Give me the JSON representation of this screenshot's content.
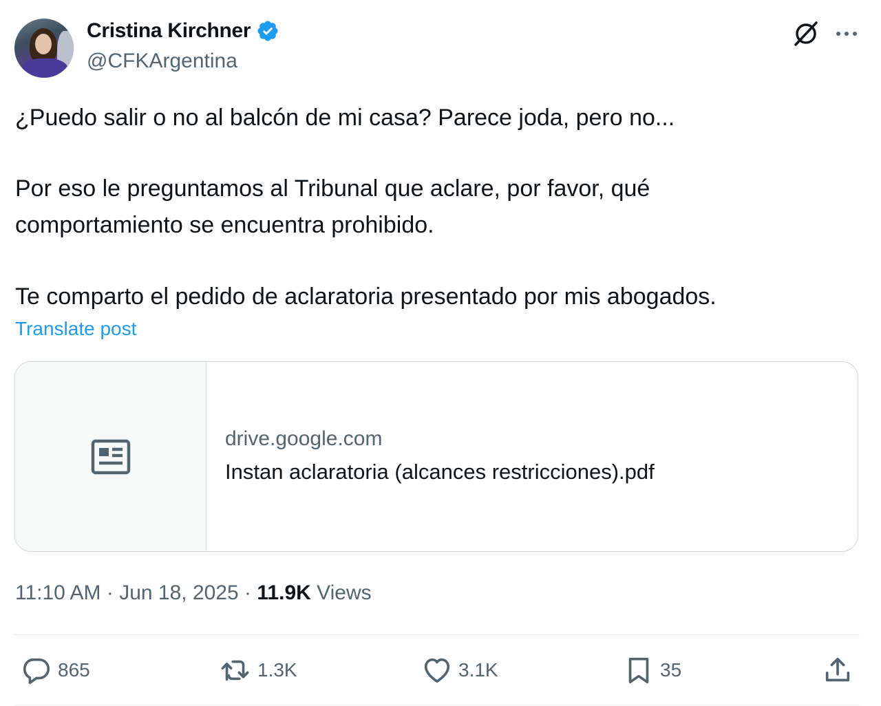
{
  "author": {
    "display_name": "Cristina Kirchner",
    "handle": "@CFKArgentina",
    "verified": true
  },
  "tweet": {
    "paragraphs": [
      "¿Puedo salir o no al balcón de mi casa? Parece joda, pero no...",
      "Por eso le preguntamos al Tribunal que aclare, por favor, qué",
      "comportamiento se encuentra prohibido.",
      "Te comparto el pedido de aclaratoria presentado por mis abogados."
    ],
    "translate_label": "Translate post"
  },
  "link_card": {
    "domain": "drive.google.com",
    "title": "Instan aclaratoria (alcances restricciones).pdf",
    "thumbnail_icon": "article-icon"
  },
  "meta": {
    "time": "11:10 AM",
    "separator": "·",
    "date": "Jun 18, 2025",
    "views_count": "11.9K",
    "views_label": "Views"
  },
  "actions": {
    "replies": "865",
    "reposts": "1.3K",
    "likes": "3.1K",
    "bookmarks": "35"
  },
  "colors": {
    "accent": "#1d9bf0",
    "secondary_text": "#536471",
    "primary_text": "#0f1419",
    "border": "#cfd9de"
  }
}
